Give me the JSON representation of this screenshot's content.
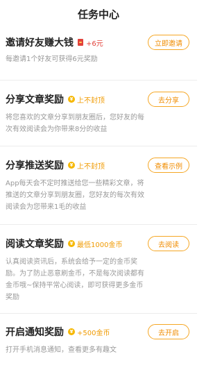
{
  "header": {
    "title": "任务中心"
  },
  "tasks": [
    {
      "name": "邀请好友赚大钱",
      "reward": "+6元",
      "button": "立即邀请",
      "desc": "每邀请1个好友可获得6元奖励"
    },
    {
      "name": "分享文章奖励",
      "reward": "上不封顶",
      "button": "去分享",
      "desc": "将您喜欢的文章分享到朋友圈后，您好友的每次有效阅读会为你带来8分的收益"
    },
    {
      "name": "分享推送奖励",
      "reward": "上不封顶",
      "button": "查看示例",
      "desc": "App每天会不定时推送给您一些精彩文章，将推送的文章分享到朋友圈，您好友的每次有效阅读会为您带来1毛的收益"
    },
    {
      "name": "阅读文章奖励",
      "reward": "最低1000金币",
      "button": "去阅读",
      "desc": "认真阅读资讯后，系统会给予一定的金币奖励。为了防止恶意刷金币，不是每次阅读都有金币哦~保持平常心阅读，即可获得更多金币奖励"
    },
    {
      "name": "开启通知奖励",
      "reward": "+500金币",
      "button": "去开启",
      "desc": "打开手机消息通知，查看更多有趣文"
    }
  ],
  "icons": {
    "invite_reward": "red-envelope-icon",
    "coin": "gold-coin-icon"
  },
  "colors": {
    "accent": "#f5a623",
    "red": "#e2423b",
    "coin": "#f6b700"
  }
}
